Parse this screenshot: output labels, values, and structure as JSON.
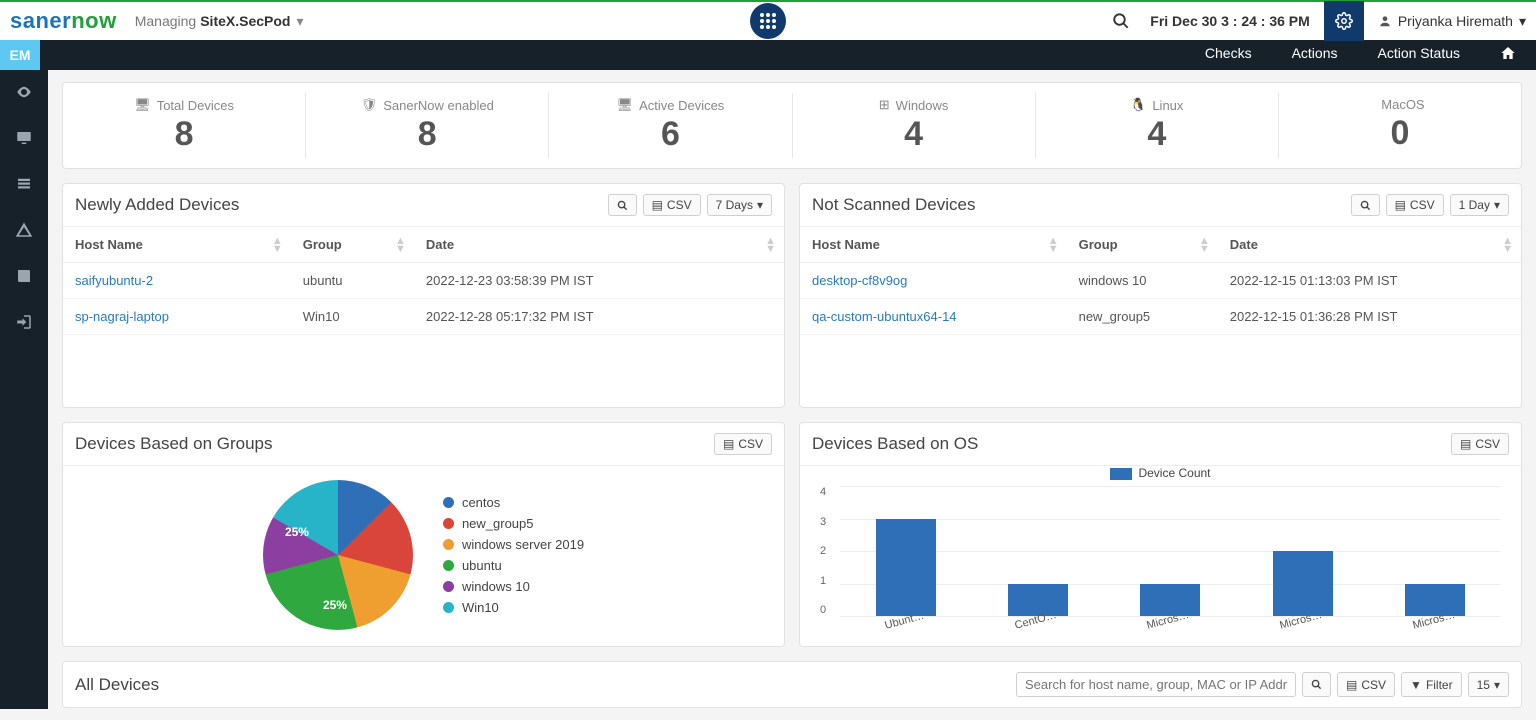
{
  "topbar": {
    "logo_a": "saner",
    "logo_b": "now",
    "managing": "Managing",
    "site": "SiteX.SecPod",
    "datetime": "Fri Dec 30  3 : 24 : 36 PM",
    "user": "Priyanka Hiremath"
  },
  "navbar": {
    "pill": "EM",
    "links": [
      "Checks",
      "Actions",
      "Action Status"
    ]
  },
  "stats": [
    {
      "label": "Total Devices",
      "value": "8",
      "icon": "monitor"
    },
    {
      "label": "SanerNow enabled",
      "value": "8",
      "icon": "shield"
    },
    {
      "label": "Active Devices",
      "value": "6",
      "icon": "monitor"
    },
    {
      "label": "Windows",
      "value": "4",
      "icon": "windows"
    },
    {
      "label": "Linux",
      "value": "4",
      "icon": "linux"
    },
    {
      "label": "MacOS",
      "value": "0",
      "icon": "apple"
    }
  ],
  "newly": {
    "title": "Newly Added Devices",
    "csv": "CSV",
    "range": "7 Days",
    "cols": [
      "Host Name",
      "Group",
      "Date"
    ],
    "rows": [
      {
        "host": "saifyubuntu-2",
        "group": "ubuntu",
        "date": "2022-12-23 03:58:39 PM IST"
      },
      {
        "host": "sp-nagraj-laptop",
        "group": "Win10",
        "date": "2022-12-28 05:17:32 PM IST"
      }
    ]
  },
  "notscanned": {
    "title": "Not Scanned Devices",
    "csv": "CSV",
    "range": "1 Day",
    "cols": [
      "Host Name",
      "Group",
      "Date"
    ],
    "rows": [
      {
        "host": "desktop-cf8v9og",
        "group": "windows 10",
        "date": "2022-12-15 01:13:03 PM IST"
      },
      {
        "host": "qa-custom-ubuntux64-14",
        "group": "new_group5",
        "date": "2022-12-15 01:36:28 PM IST"
      }
    ]
  },
  "groups_chart": {
    "title": "Devices Based on Groups",
    "csv": "CSV"
  },
  "os_chart": {
    "title": "Devices Based on OS",
    "csv": "CSV",
    "legend": "Device Count"
  },
  "chart_data": [
    {
      "type": "pie",
      "title": "Devices Based on Groups",
      "series": [
        {
          "name": "centos",
          "value": 12.5,
          "color": "#2f6fb7"
        },
        {
          "name": "new_group5",
          "value": 16.7,
          "color": "#d9453a"
        },
        {
          "name": "windows server 2019",
          "value": 16.7,
          "color": "#ef9f2f"
        },
        {
          "name": "ubuntu",
          "value": 25,
          "color": "#2fa83f"
        },
        {
          "name": "windows 10",
          "value": 12.5,
          "color": "#8c3fa0"
        },
        {
          "name": "Win10",
          "value": 25,
          "color": "#27b4c9"
        }
      ],
      "labels_shown": [
        "25%",
        "25%"
      ]
    },
    {
      "type": "bar",
      "title": "Devices Based on OS",
      "ylabel": "",
      "ylim": [
        0,
        4
      ],
      "yticks": [
        0,
        1,
        2,
        3,
        4
      ],
      "categories": [
        "Ubunt…",
        "CentO…",
        "Micros…",
        "Micros…",
        "Micros…"
      ],
      "series": [
        {
          "name": "Device Count",
          "values": [
            3,
            1,
            1,
            2,
            1
          ],
          "color": "#2f6fb7"
        }
      ]
    }
  ],
  "alldevices": {
    "title": "All Devices",
    "placeholder": "Search for host name, group, MAC or IP Address",
    "csv": "CSV",
    "filter": "Filter",
    "page": "15"
  }
}
